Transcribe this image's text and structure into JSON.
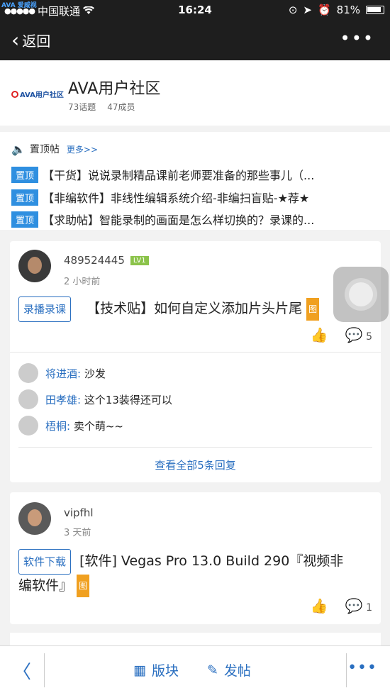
{
  "status_bar": {
    "signal_dots": "●●●●●",
    "carrier": "中国联通",
    "time": "16:24",
    "battery": "81%",
    "watermark": "AVA 爱威视"
  },
  "nav": {
    "back_label": "返回",
    "more_label": "•••"
  },
  "community": {
    "logo_text": "AVA用户社区",
    "title": "AVA用户社区",
    "topics": "73话题",
    "members": "47成员"
  },
  "pinned": {
    "header": "置顶帖",
    "more_link": "更多>>",
    "items": [
      {
        "tag": "置顶",
        "text": "【干货】说说录制精品课前老师要准备的那些事儿（..."
      },
      {
        "tag": "置顶",
        "text": "【非编软件】非线性编辑系统介绍-非编扫盲贴-★荐★"
      },
      {
        "tag": "置顶",
        "text": "【求助帖】智能录制的画面是怎么样切换的？录课的..."
      }
    ]
  },
  "posts": [
    {
      "username": "489524445",
      "level": "LV1",
      "time": "2 小时前",
      "category": "录播录课",
      "title": "【技术贴】如何自定义添加片头片尾",
      "image_tag": "图",
      "comment_count": "5",
      "replies": [
        {
          "name": "将进酒:",
          "text": "沙发"
        },
        {
          "name": "田孝雄:",
          "text": "这个13装得还可以"
        },
        {
          "name": "梧桐:",
          "text": "卖个萌~~"
        }
      ],
      "view_all": "查看全部5条回复"
    },
    {
      "username": "vipfhl",
      "time": "3 天前",
      "category": "软件下载",
      "title_line1": "[软件] Vegas Pro 13.0 Build 290『视频非",
      "title_line2": "编软件』",
      "image_tag": "图",
      "comment_count": "1"
    }
  ],
  "bottom_bar": {
    "back": "〈",
    "sections_label": "版块",
    "post_label": "发帖",
    "more": "•••"
  },
  "colors": {
    "accent": "#2a6fc0",
    "pin_tag": "#2f8fe0",
    "level_badge": "#8bc34a",
    "image_tag": "#f0a020",
    "dark_bar": "#1e1e1e"
  }
}
